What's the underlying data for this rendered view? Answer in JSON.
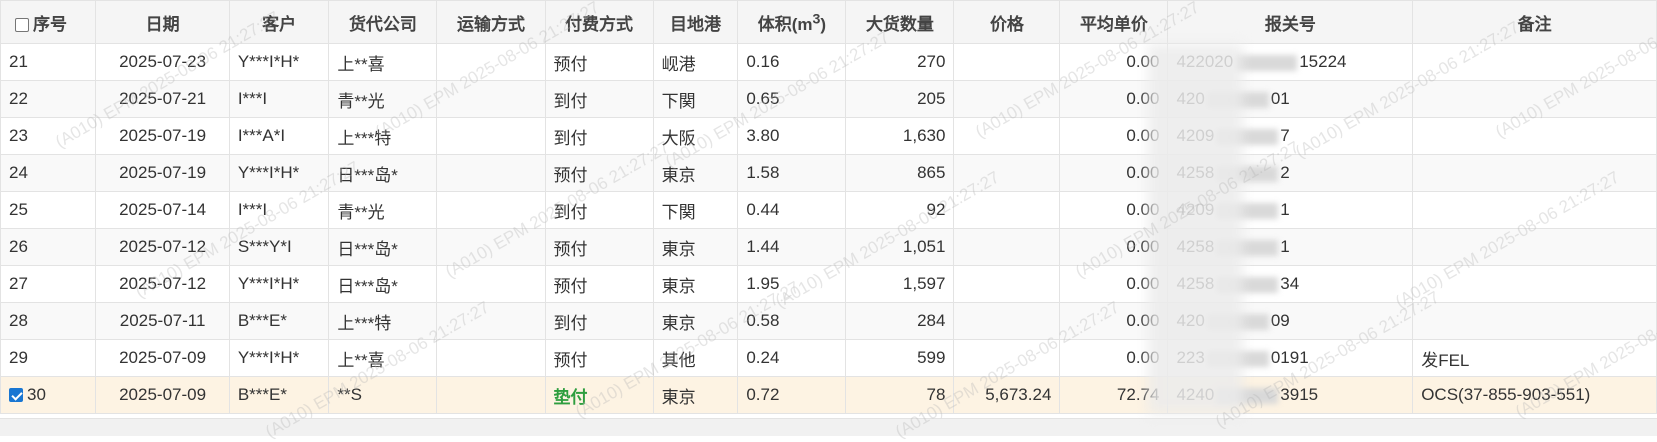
{
  "columns": {
    "idx": "序号",
    "date": "日期",
    "customer": "客户",
    "forwarder": "货代公司",
    "transport": "运输方式",
    "payment": "付费方式",
    "port": "目地港",
    "volume_prefix": "体积(m",
    "volume_sup": "3",
    "volume_suffix": ")",
    "qty": "大货数量",
    "price": "价格",
    "unit_price": "平均单价",
    "customs_no": "报关号",
    "remark": "备注"
  },
  "rows": [
    {
      "idx": "21",
      "date": "2025-07-23",
      "customer": "Y***I*H*",
      "forwarder": "上**喜",
      "transport": "",
      "payment": "预付",
      "port": "岘港",
      "volume": "0.16",
      "qty": "270",
      "price": "",
      "unit_price": "0.00",
      "customs_a": "422020",
      "customs_b": "15224",
      "remark": "",
      "checked": false,
      "selected": false,
      "special_pay": false
    },
    {
      "idx": "22",
      "date": "2025-07-21",
      "customer": "I***I",
      "forwarder": "青**光",
      "transport": "",
      "payment": "到付",
      "port": "下関",
      "volume": "0.65",
      "qty": "205",
      "price": "",
      "unit_price": "0.00",
      "customs_a": "420",
      "customs_b": "01",
      "remark": "",
      "checked": false,
      "selected": false,
      "special_pay": false
    },
    {
      "idx": "23",
      "date": "2025-07-19",
      "customer": "I***A*I",
      "forwarder": "上***特",
      "transport": "",
      "payment": "到付",
      "port": "大阪",
      "volume": "3.80",
      "qty": "1,630",
      "price": "",
      "unit_price": "0.00",
      "customs_a": "4209",
      "customs_b": "7",
      "remark": "",
      "checked": false,
      "selected": false,
      "special_pay": false
    },
    {
      "idx": "24",
      "date": "2025-07-19",
      "customer": "Y***I*H*",
      "forwarder": "日***岛*",
      "transport": "",
      "payment": "预付",
      "port": "東京",
      "volume": "1.58",
      "qty": "865",
      "price": "",
      "unit_price": "0.00",
      "customs_a": "4258",
      "customs_b": "2",
      "remark": "",
      "checked": false,
      "selected": false,
      "special_pay": false
    },
    {
      "idx": "25",
      "date": "2025-07-14",
      "customer": "I***I",
      "forwarder": "青**光",
      "transport": "",
      "payment": "到付",
      "port": "下関",
      "volume": "0.44",
      "qty": "92",
      "price": "",
      "unit_price": "0.00",
      "customs_a": "4209",
      "customs_b": "1",
      "remark": "",
      "checked": false,
      "selected": false,
      "special_pay": false
    },
    {
      "idx": "26",
      "date": "2025-07-12",
      "customer": "S***Y*I",
      "forwarder": "日***岛*",
      "transport": "",
      "payment": "预付",
      "port": "東京",
      "volume": "1.44",
      "qty": "1,051",
      "price": "",
      "unit_price": "0.00",
      "customs_a": "4258",
      "customs_b": "1",
      "remark": "",
      "checked": false,
      "selected": false,
      "special_pay": false
    },
    {
      "idx": "27",
      "date": "2025-07-12",
      "customer": "Y***I*H*",
      "forwarder": "日***岛*",
      "transport": "",
      "payment": "预付",
      "port": "東京",
      "volume": "1.95",
      "qty": "1,597",
      "price": "",
      "unit_price": "0.00",
      "customs_a": "4258",
      "customs_b": "34",
      "remark": "",
      "checked": false,
      "selected": false,
      "special_pay": false
    },
    {
      "idx": "28",
      "date": "2025-07-11",
      "customer": "B***E*",
      "forwarder": "上***特",
      "transport": "",
      "payment": "到付",
      "port": "東京",
      "volume": "0.58",
      "qty": "284",
      "price": "",
      "unit_price": "0.00",
      "customs_a": "420",
      "customs_b": "09",
      "remark": "",
      "checked": false,
      "selected": false,
      "special_pay": false
    },
    {
      "idx": "29",
      "date": "2025-07-09",
      "customer": "Y***I*H*",
      "forwarder": "上**喜",
      "transport": "",
      "payment": "预付",
      "port": "其他",
      "volume": "0.24",
      "qty": "599",
      "price": "",
      "unit_price": "0.00",
      "customs_a": "223",
      "customs_b": "0191",
      "remark": "发FEL",
      "checked": false,
      "selected": false,
      "special_pay": false
    },
    {
      "idx": "30",
      "date": "2025-07-09",
      "customer": "B***E*",
      "forwarder": "**S",
      "transport": "",
      "payment": "垫付",
      "port": "東京",
      "volume": "0.72",
      "qty": "78",
      "price": "5,673.24",
      "unit_price": "72.74",
      "customs_a": "4240",
      "customs_b": "3915",
      "remark": "OCS(37-855-903-551)",
      "checked": true,
      "selected": true,
      "special_pay": true
    }
  ],
  "watermark": "(A010) EPM  2025-08-06 21:27:27",
  "colors": {
    "selected_row": "#fdf3e3",
    "special_payment": "#2e9e3f",
    "checkbox_checked": "#1976d2"
  }
}
